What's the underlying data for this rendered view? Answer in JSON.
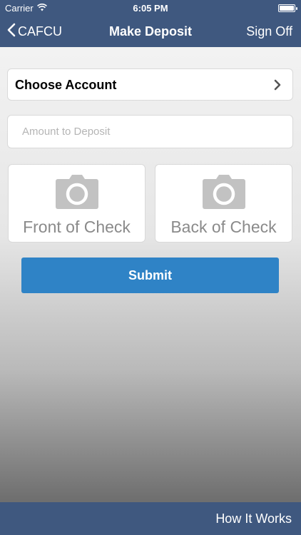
{
  "status_bar": {
    "carrier": "Carrier",
    "time": "6:05 PM",
    "battery_level": 1.0
  },
  "nav": {
    "back_label": "CAFCU",
    "title": "Make Deposit",
    "right_label": "Sign Off"
  },
  "account": {
    "label": "Choose Account"
  },
  "amount": {
    "placeholder": "Amount to Deposit",
    "value": ""
  },
  "checks": {
    "front_label": "Front of Check",
    "back_label": "Back of Check"
  },
  "submit_label": "Submit",
  "footer": {
    "how_label": "How It Works"
  },
  "colors": {
    "nav_bar": "#3f587f",
    "submit_button": "#2f83c6",
    "camera_icon": "#c2c2c2"
  },
  "icons": [
    "wifi-icon",
    "battery-icon",
    "chevron-left-icon",
    "chevron-right-icon",
    "camera-icon"
  ]
}
